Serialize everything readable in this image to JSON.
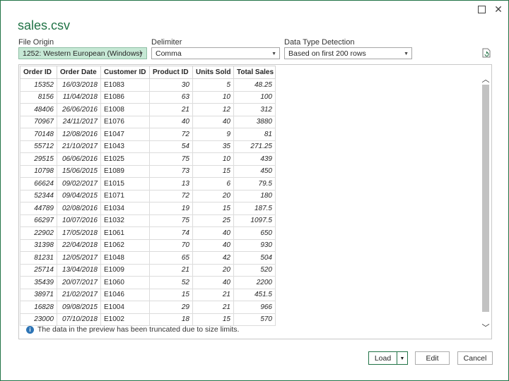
{
  "window": {
    "title": "sales.csv"
  },
  "options": {
    "file_origin": {
      "label": "File Origin",
      "value": "1252: Western European (Windows)"
    },
    "delimiter": {
      "label": "Delimiter",
      "value": "Comma"
    },
    "detection": {
      "label": "Data Type Detection",
      "value": "Based on first 200 rows"
    }
  },
  "table": {
    "columns": [
      "Order ID",
      "Order Date",
      "Customer ID",
      "Product ID",
      "Units Sold",
      "Total Sales"
    ],
    "rows": [
      [
        "15352",
        "16/03/2018",
        "E1083",
        "30",
        "5",
        "48.25"
      ],
      [
        "8156",
        "11/04/2018",
        "E1086",
        "63",
        "10",
        "100"
      ],
      [
        "48406",
        "26/06/2016",
        "E1008",
        "21",
        "12",
        "312"
      ],
      [
        "70967",
        "24/11/2017",
        "E1076",
        "40",
        "40",
        "3880"
      ],
      [
        "70148",
        "12/08/2016",
        "E1047",
        "72",
        "9",
        "81"
      ],
      [
        "55712",
        "21/10/2017",
        "E1043",
        "54",
        "35",
        "271.25"
      ],
      [
        "29515",
        "06/06/2016",
        "E1025",
        "75",
        "10",
        "439"
      ],
      [
        "10798",
        "15/06/2015",
        "E1089",
        "73",
        "15",
        "450"
      ],
      [
        "66624",
        "09/02/2017",
        "E1015",
        "13",
        "6",
        "79.5"
      ],
      [
        "52344",
        "09/04/2015",
        "E1071",
        "72",
        "20",
        "180"
      ],
      [
        "44789",
        "02/08/2016",
        "E1034",
        "19",
        "15",
        "187.5"
      ],
      [
        "66297",
        "10/07/2016",
        "E1032",
        "75",
        "25",
        "1097.5"
      ],
      [
        "22902",
        "17/05/2018",
        "E1061",
        "74",
        "40",
        "650"
      ],
      [
        "31398",
        "22/04/2018",
        "E1062",
        "70",
        "40",
        "930"
      ],
      [
        "81231",
        "12/05/2017",
        "E1048",
        "65",
        "42",
        "504"
      ],
      [
        "25714",
        "13/04/2018",
        "E1009",
        "21",
        "20",
        "520"
      ],
      [
        "35439",
        "20/07/2017",
        "E1060",
        "52",
        "40",
        "2200"
      ],
      [
        "38971",
        "21/02/2017",
        "E1046",
        "15",
        "21",
        "451.5"
      ],
      [
        "16828",
        "09/08/2015",
        "E1004",
        "29",
        "21",
        "966"
      ],
      [
        "23000",
        "07/10/2018",
        "E1002",
        "18",
        "15",
        "570"
      ]
    ]
  },
  "notice": {
    "text": "The data in the preview has been truncated due to size limits."
  },
  "buttons": {
    "load": "Load",
    "edit": "Edit",
    "cancel": "Cancel"
  },
  "colors": {
    "accent": "#217346",
    "origin_bg": "#c6e8d5",
    "info": "#2e75b6"
  }
}
